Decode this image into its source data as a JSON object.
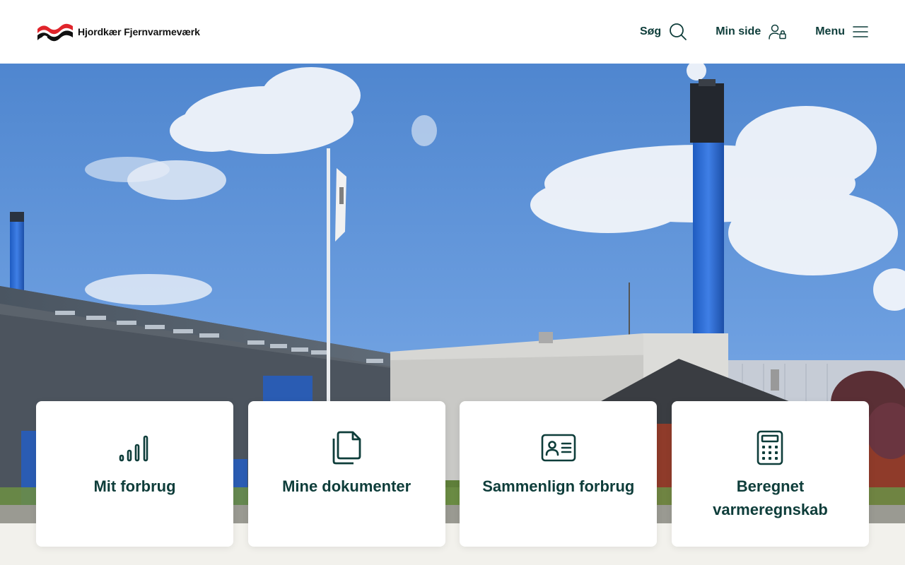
{
  "brand": {
    "name": "Hjordkær Fjernvarmeværk",
    "logo_red": "#e0242b",
    "logo_black": "#111111"
  },
  "header": {
    "search_label": "Søg",
    "mypage_label": "Min side",
    "menu_label": "Menu"
  },
  "colors": {
    "primary": "#0e3d3a",
    "background": "#f2f1ec",
    "card": "#ffffff"
  },
  "quicklinks": [
    {
      "label": "Mit forbrug",
      "icon": "signal-bars-icon"
    },
    {
      "label": "Mine dokumenter",
      "icon": "documents-icon"
    },
    {
      "label": "Sammenlign forbrug",
      "icon": "id-card-icon"
    },
    {
      "label": "Beregnet varmeregnskab",
      "icon": "calculator-icon"
    }
  ]
}
